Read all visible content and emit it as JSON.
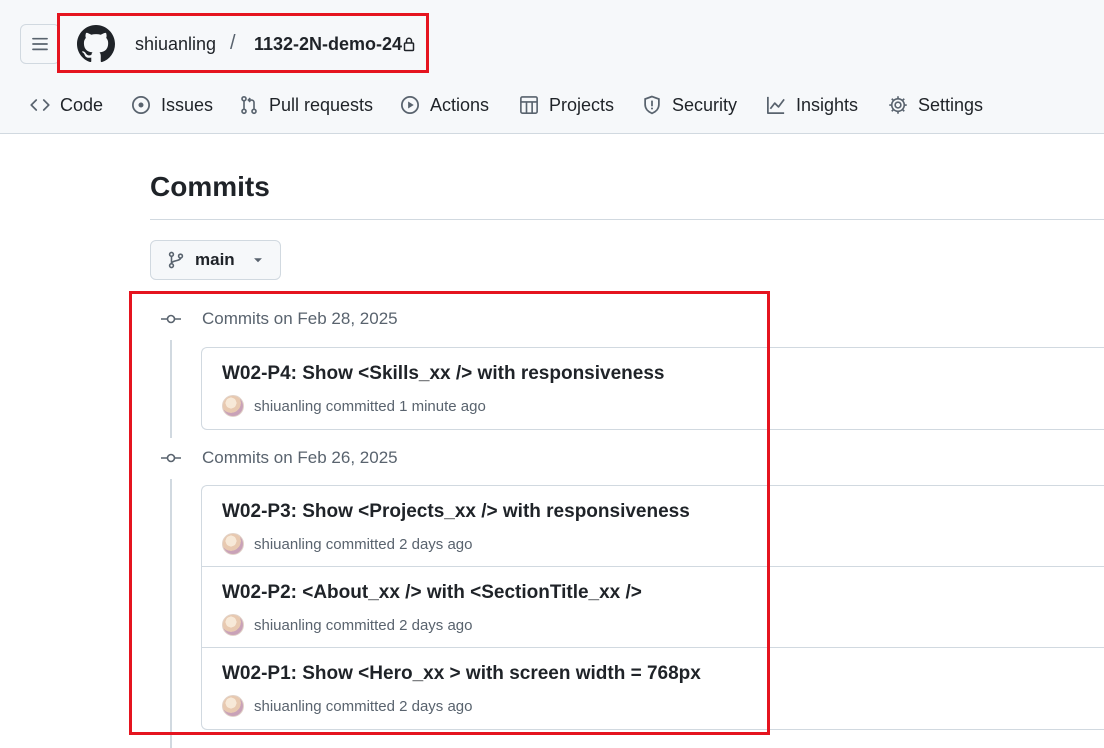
{
  "header": {
    "owner": "shiuanling",
    "separator": "/",
    "repo": "1132-2N-demo-24"
  },
  "tabs": [
    {
      "label": "Code",
      "icon": "code-icon"
    },
    {
      "label": "Issues",
      "icon": "issue-icon"
    },
    {
      "label": "Pull requests",
      "icon": "pull-request-icon"
    },
    {
      "label": "Actions",
      "icon": "actions-icon"
    },
    {
      "label": "Projects",
      "icon": "projects-icon"
    },
    {
      "label": "Security",
      "icon": "shield-icon"
    },
    {
      "label": "Insights",
      "icon": "graph-icon"
    },
    {
      "label": "Settings",
      "icon": "gear-icon"
    }
  ],
  "page": {
    "title": "Commits",
    "branch": "main"
  },
  "groups": [
    {
      "heading": "Commits on Feb 28, 2025",
      "commits": [
        {
          "message": "W02-P4: Show <Skills_xx /> with responsiveness",
          "author": "shiuanling",
          "verb": "committed",
          "time": "1 minute ago"
        }
      ]
    },
    {
      "heading": "Commits on Feb 26, 2025",
      "commits": [
        {
          "message": "W02-P3: Show <Projects_xx /> with responsiveness",
          "author": "shiuanling",
          "verb": "committed",
          "time": "2 days ago"
        },
        {
          "message": "W02-P2: <About_xx /> with <SectionTitle_xx />",
          "author": "shiuanling",
          "verb": "committed",
          "time": "2 days ago"
        },
        {
          "message": "W02-P1: Show <Hero_xx > with screen width = 768px",
          "author": "shiuanling",
          "verb": "committed",
          "time": "2 days ago"
        }
      ]
    }
  ],
  "colors": {
    "highlight": "#e5141f",
    "border": "#d1d9e0",
    "muted": "#59636e",
    "header_bg": "#f6f8fa"
  }
}
